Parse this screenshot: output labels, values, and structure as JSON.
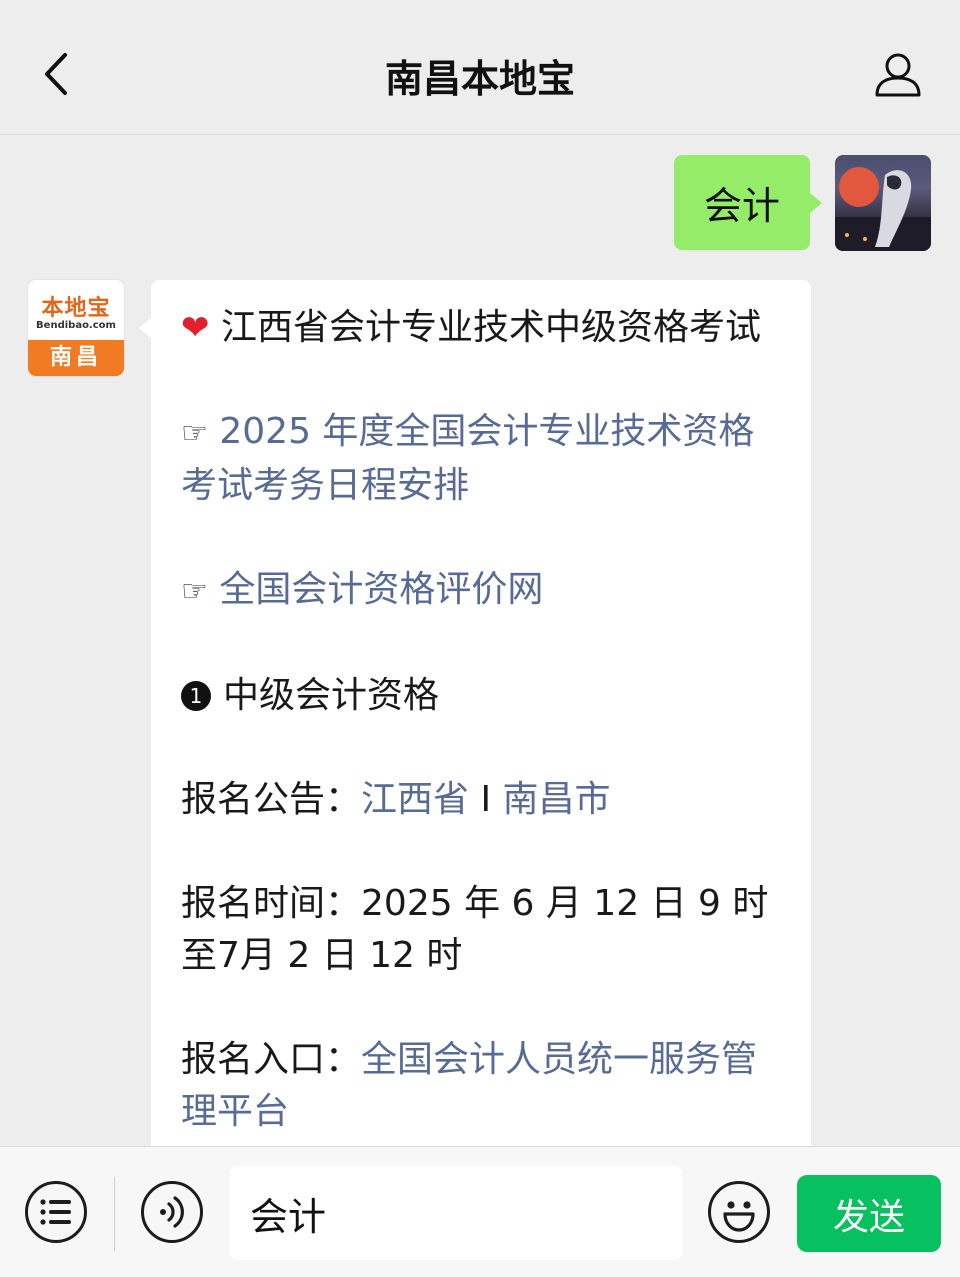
{
  "header": {
    "title": "南昌本地宝",
    "back_icon": "chevron-left-icon",
    "profile_icon": "person-icon"
  },
  "messages": {
    "outgoing": {
      "text": "会计"
    },
    "incoming": {
      "avatar": {
        "logo_text": "本地宝",
        "logo_url": "Bendibao.com",
        "city": "南昌"
      },
      "title": "江西省会计专业技术中级资格考试",
      "link_schedule": "2025 年度全国会计专业技术资格考试考务日程安排",
      "link_site": "全国会计资格评价网",
      "section_heading": "中级会计资格",
      "section_number": "1",
      "notice_label": "报名公告：",
      "notice_link_province": "江西省",
      "notice_separator": " I ",
      "notice_link_city": "南昌市",
      "time_label": "报名时间：",
      "time_value": "2025 年 6 月 12 日 9 时至7月 2 日 12 时",
      "entry_label": "报名入口：",
      "entry_link": "全国会计人员统一服务管理平台"
    }
  },
  "input_bar": {
    "input_value": "会计",
    "send_label": "发送"
  },
  "colors": {
    "background": "#ededed",
    "outgoing_bubble": "#95ec69",
    "link": "#576b95",
    "send_button": "#07c160",
    "brand_orange": "#f07b22"
  }
}
